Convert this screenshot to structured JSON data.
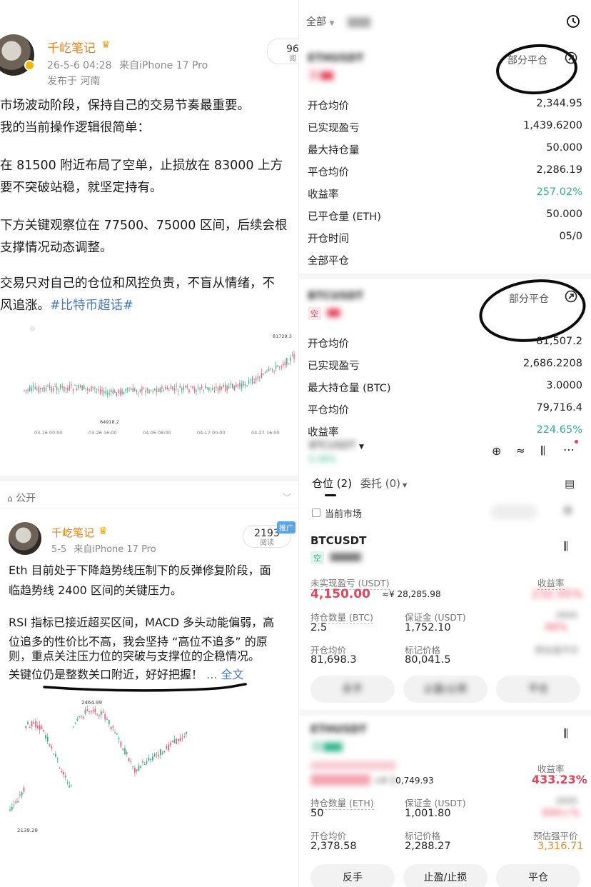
{
  "left": {
    "post1": {
      "username": "千屹笔记",
      "crown_icon": "crown-icon",
      "timestamp": "26-5-6 04:28",
      "device": "来自iPhone 17 Pro",
      "location": "发布于 河南",
      "read_count_partial": "96",
      "read_label_partial": "阅",
      "lines": [
        "市场波动阶段，保持自己的交易节奏最重要。",
        "我的当前操作逻辑很简单：",
        "",
        "在 81500 附近布局了空单，止损放在 83000 上方",
        "要不突破站稳，就坚定持有。",
        "",
        "下方关键观察位在 77500、75000 区间，后续会根",
        "支撑情况动态调整。",
        "",
        "交易只对自己的仓位和风控负责，不盲从情绪，不",
        "风追涨。"
      ],
      "topic": "#比特币超话#",
      "chart": {
        "high_label": "81729.3",
        "low_label": "64918.2",
        "x_labels": [
          "03-16 00:00",
          "03-26 16:00",
          "04-06 08:00",
          "04-17 00:00",
          "04-27 16:00"
        ]
      }
    },
    "public_label": "公开",
    "post2": {
      "username": "千屹笔记",
      "timestamp": "5-5",
      "device": "来自iPhone 17 Pro",
      "read_count": "2193",
      "read_label": "阅读",
      "promo_badge": "推广",
      "lines": [
        "Eth 目前处于下降趋势线压制下的反弹修复阶段，面",
        "临趋势线 2400 区间的关键压力。",
        "",
        "RSI 指标已接近超买区间，MACD 多头动能偏弱，高",
        "位追多的性价比不高，我会坚持 “高位不追多” 的原",
        "则，重点关注压力位的突破与支撑位的企稳情况。"
      ],
      "last_line": "关键位仍是整数关口附近，好好把握！",
      "more_label": "... 全文",
      "chart": {
        "high_label": "2464.99",
        "low_label": "2139.28"
      }
    }
  },
  "right": {
    "top_filter": "全部",
    "history_icon": "clock-icon",
    "eth_history": {
      "symbol": "ETHUSDT",
      "partial_close": "部分平仓",
      "rows": [
        {
          "k": "开仓均价",
          "v": "2,344.95"
        },
        {
          "k": "已实现盈亏",
          "v": "1,439.6200"
        },
        {
          "k": "最大持仓量",
          "v": "50.000"
        },
        {
          "k": "平仓均价",
          "v": "2,286.19"
        },
        {
          "k": "收益率",
          "v": "257.02%"
        },
        {
          "k": "已平仓量 (ETH)",
          "v": "50.000"
        },
        {
          "k": "开仓时间",
          "v": "05/0"
        },
        {
          "k": "全部平仓",
          "v": ""
        }
      ]
    },
    "btc_history": {
      "symbol": "BTCUSDT",
      "side": "空",
      "partial_close": "部分平仓",
      "rows": [
        {
          "k": "开仓均价",
          "v": "81,507.2"
        },
        {
          "k": "已实现盈亏",
          "v": "2,686.2208"
        },
        {
          "k": "最大持仓量 (BTC)",
          "v": "3.0000"
        },
        {
          "k": "平仓均价",
          "v": "79,716.4"
        },
        {
          "k": "收益率",
          "v": "224.65%"
        }
      ]
    },
    "market_bar": {
      "symbol": "BTCUSDT",
      "change": "0.58%"
    },
    "tabs": {
      "positions": "仓位 (2)",
      "orders": "委托 (0)"
    },
    "current_market": "当前市场",
    "position_btc": {
      "symbol": "BTCUSDT",
      "side": "空",
      "unrealized_label": "未实现盈亏 (USDT)",
      "unrealized_value": "4,150.00",
      "unrealized_cny": "≈¥ 28,285.98",
      "roe_label": "收益率",
      "roe_value": "232.05%",
      "qty_label": "持仓数量 (BTC)",
      "qty_value": "2.5",
      "margin_label": "保证金 (USDT)",
      "margin_value": "1,752.10",
      "mmr_label": "MMR",
      "mmr_value": "98%",
      "entry_label": "开仓均价",
      "entry_value": "81,698.3",
      "mark_label": "标记价格",
      "mark_value": "80,041.5",
      "liq_label": "预估强平价",
      "btn_reverse": "反手",
      "btn_tpsl": "止盈/止损",
      "btn_close": "平仓"
    },
    "position_eth": {
      "symbol": "ETHUSDT",
      "unrealized_cny": "0,749.93",
      "roe_label": "收益率",
      "roe_value": "433.23%",
      "qty_label": "持仓数量 (ETH)",
      "qty_value": "50",
      "margin_label": "保证金 (USDT)",
      "margin_value": "1,001.80",
      "mmr_label": "MMR",
      "mmr_value": "999+%",
      "entry_label": "开仓均价",
      "entry_value": "2,378.58",
      "mark_label": "标记价格",
      "mark_value": "2,288.27",
      "liq_label": "预估强平价",
      "liq_value": "3,316.71",
      "btn_reverse": "反手",
      "btn_tpsl": "止盈/止损",
      "btn_close": "平仓"
    }
  }
}
